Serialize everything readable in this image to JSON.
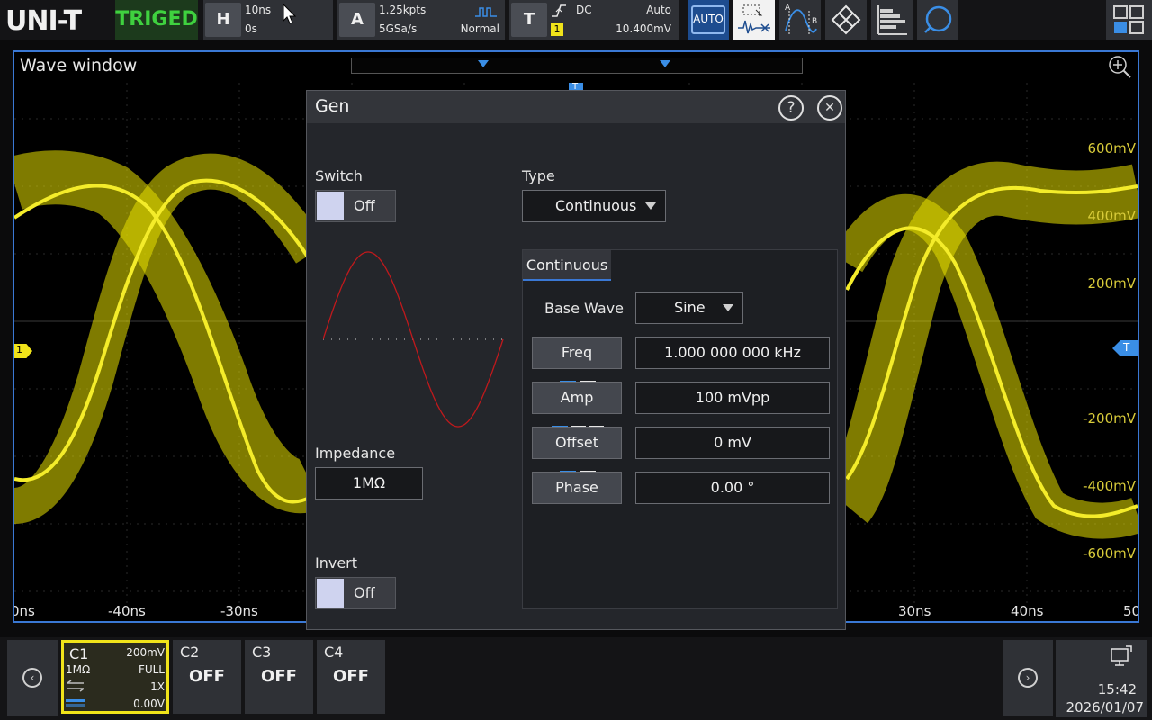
{
  "topbar": {
    "logo": "UNI-T",
    "trigger_status": "TRIGED",
    "horizontal": {
      "key": "H",
      "scale": "10ns",
      "offset": "0s"
    },
    "acquire": {
      "key": "A",
      "memory_depth": "1.25kpts",
      "sample_rate": "5GSa/s",
      "mode": "Normal"
    },
    "trigger": {
      "key": "T",
      "coupling": "DC",
      "sweep": "Auto",
      "source": "1",
      "level": "10.400mV"
    },
    "auto_label": "AUTO",
    "icons": [
      "auto-icon",
      "wave-select-icon",
      "cursor-ab-icon",
      "measure-cross-icon",
      "histogram-icon",
      "search-icon",
      "window-layout-icon"
    ]
  },
  "wave_window": {
    "title": "Wave window",
    "y_labels": [
      "600mV",
      "400mV",
      "200mV",
      "-200mV",
      "-400mV",
      "-600mV"
    ],
    "x_labels": [
      "0ns",
      "-40ns",
      "-30ns",
      "30ns",
      "40ns",
      "50"
    ],
    "ch1_marker": "1",
    "trigger_marker": "T",
    "top_marker": "T",
    "trace_color": "#e8e000"
  },
  "gen": {
    "title": "Gen",
    "help_icon": "?",
    "close_icon": "✕",
    "switch": {
      "label": "Switch",
      "value": "Off"
    },
    "type": {
      "label": "Type",
      "value": "Continuous"
    },
    "impedance": {
      "label": "Impedance",
      "value": "1MΩ"
    },
    "invert": {
      "label": "Invert",
      "value": "Off"
    },
    "preview_color": "#c0191c",
    "tab": "Continuous",
    "base_wave": {
      "label": "Base Wave",
      "value": "Sine"
    },
    "freq": {
      "label": "Freq",
      "value": "1.000 000 000 kHz"
    },
    "amp": {
      "label": "Amp",
      "value": "100 mVpp"
    },
    "offset": {
      "label": "Offset",
      "value": "0 mV"
    },
    "phase": {
      "label": "Phase",
      "value": "0.00 °"
    }
  },
  "bottombar": {
    "c1": {
      "name": "C1",
      "scale": "200mV",
      "impedance": "1MΩ",
      "bandwidth": "FULL",
      "probe": "1X",
      "offset": "0.00V",
      "color": "#f0e31a"
    },
    "channels": [
      {
        "name": "C2",
        "state": "OFF"
      },
      {
        "name": "C3",
        "state": "OFF"
      },
      {
        "name": "C4",
        "state": "OFF"
      }
    ],
    "time": "15:42",
    "date": "2026/01/07"
  }
}
